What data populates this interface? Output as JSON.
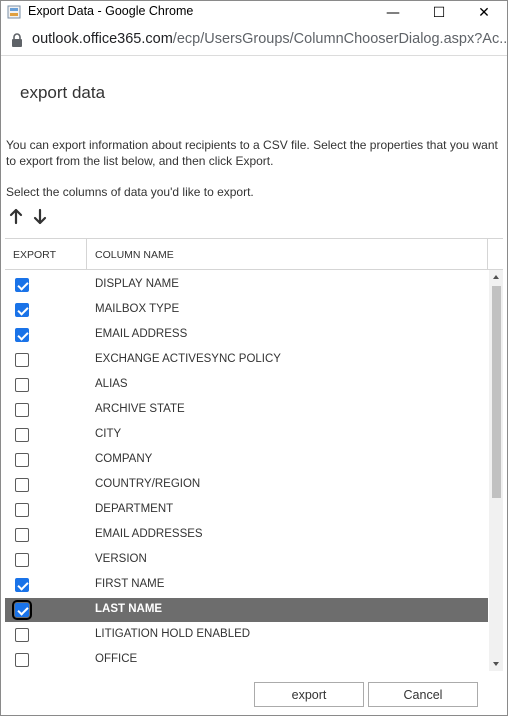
{
  "window": {
    "title": "Export Data - Google Chrome",
    "minimize_glyph": "—",
    "maximize_glyph": "☐",
    "close_glyph": "✕"
  },
  "address": {
    "domain": "outlook.office365.com",
    "path": "/ecp/UsersGroups/ColumnChooserDialog.aspx?Ac..."
  },
  "dialog": {
    "title": "export data",
    "description": "You can export information about recipients to a CSV file. Select the properties that you want to export from the list below, and then click Export.",
    "instruction": "Select the columns of data you'd like to export."
  },
  "table": {
    "headers": {
      "export": "EXPORT",
      "column_name": "COLUMN NAME"
    },
    "rows": [
      {
        "label": "DISPLAY NAME",
        "checked": true,
        "selected": false
      },
      {
        "label": "MAILBOX TYPE",
        "checked": true,
        "selected": false
      },
      {
        "label": "EMAIL ADDRESS",
        "checked": true,
        "selected": false
      },
      {
        "label": "EXCHANGE ACTIVESYNC POLICY",
        "checked": false,
        "selected": false
      },
      {
        "label": "ALIAS",
        "checked": false,
        "selected": false
      },
      {
        "label": "ARCHIVE STATE",
        "checked": false,
        "selected": false
      },
      {
        "label": "CITY",
        "checked": false,
        "selected": false
      },
      {
        "label": "COMPANY",
        "checked": false,
        "selected": false
      },
      {
        "label": "COUNTRY/REGION",
        "checked": false,
        "selected": false
      },
      {
        "label": "DEPARTMENT",
        "checked": false,
        "selected": false
      },
      {
        "label": "EMAIL ADDRESSES",
        "checked": false,
        "selected": false
      },
      {
        "label": "VERSION",
        "checked": false,
        "selected": false
      },
      {
        "label": "FIRST NAME",
        "checked": true,
        "selected": false
      },
      {
        "label": "LAST NAME",
        "checked": true,
        "selected": true
      },
      {
        "label": "LITIGATION HOLD ENABLED",
        "checked": false,
        "selected": false
      },
      {
        "label": "OFFICE",
        "checked": false,
        "selected": false
      }
    ]
  },
  "buttons": {
    "export": "export",
    "cancel": "Cancel"
  },
  "colors": {
    "checkbox_checked": "#1a73e8",
    "selected_row": "#6d6d6d"
  }
}
